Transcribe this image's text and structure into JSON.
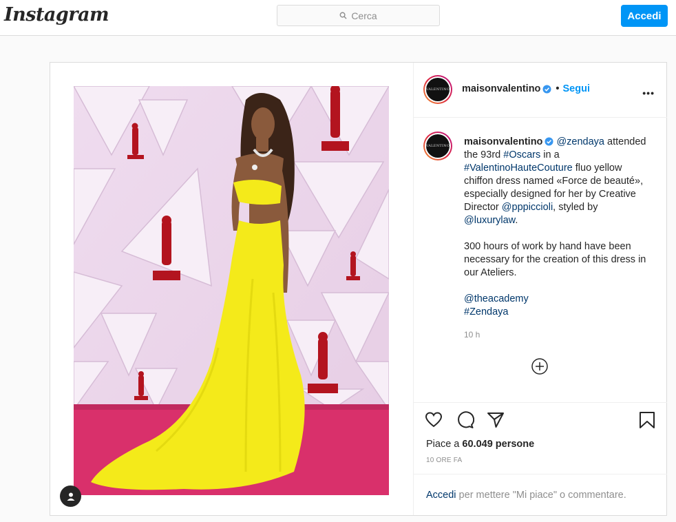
{
  "header": {
    "logo": "Instagram",
    "search_placeholder": "Cerca",
    "login_button": "Accedi"
  },
  "post": {
    "username": "maisonvalentino",
    "follow": "Segui",
    "avatar_text": "VALENTINO",
    "caption": {
      "mention_1": "@zendaya",
      "t1": " attended the 93rd ",
      "tag_1": "#Oscars",
      "t2": " in a ",
      "tag_2": "#ValentinoHauteCouture",
      "t3": " fluo yellow chiffon dress named «Force de beauté», especially designed for her by Creative Director ",
      "mention_2": "@pppiccioli",
      "t4": ", styled by ",
      "mention_3": "@luxurylaw",
      "t5": ".",
      "paragraph_2": "300 hours of work by hand have been necessary for the creation of this dress in our Ateliers.",
      "mention_4": "@theacademy",
      "tag_3": "#Zendaya"
    },
    "time": "10 h",
    "likes_prefix": "Piace a ",
    "likes_count": "60.049",
    "likes_suffix": " persone",
    "time_ago": "10 ORE FA",
    "login_link": "Accedi",
    "login_text": " per mettere \"Mi piace\" o commentare."
  },
  "colors": {
    "accent": "#0095f6",
    "link": "#00376b",
    "dress": "#f4ea1a",
    "carpet": "#d9306b"
  }
}
